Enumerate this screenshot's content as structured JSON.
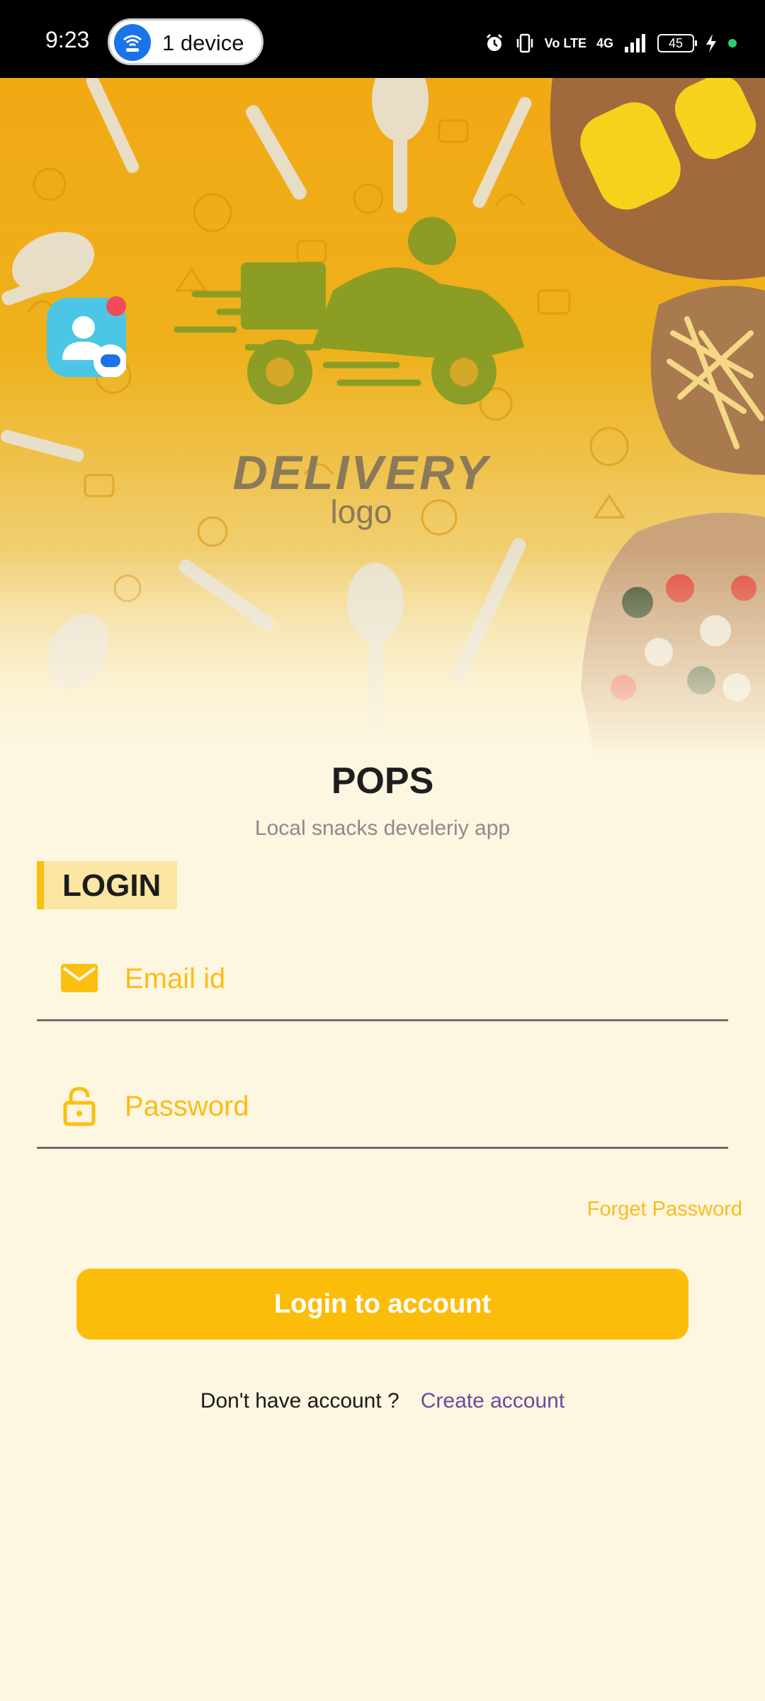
{
  "status_bar": {
    "time": "9:23",
    "hotspot_label": "1 device",
    "network_labels": [
      "Vo LTE",
      "4G"
    ],
    "battery": "45"
  },
  "hero": {
    "logo_title": "DELIVERY",
    "logo_subtitle": "logo"
  },
  "app": {
    "title": "POPS",
    "subtitle": "Local snacks develeriy app"
  },
  "login": {
    "section_label": "LOGIN",
    "email_placeholder": "Email id",
    "password_placeholder": "Password",
    "forgot_label": "Forget Password",
    "submit_label": "Login to account",
    "signup_prompt": "Don't have account ?",
    "signup_link": "Create account"
  },
  "colors": {
    "accent": "#fcbd0a",
    "background": "#fdf6e0",
    "link": "#6a4a9c"
  }
}
